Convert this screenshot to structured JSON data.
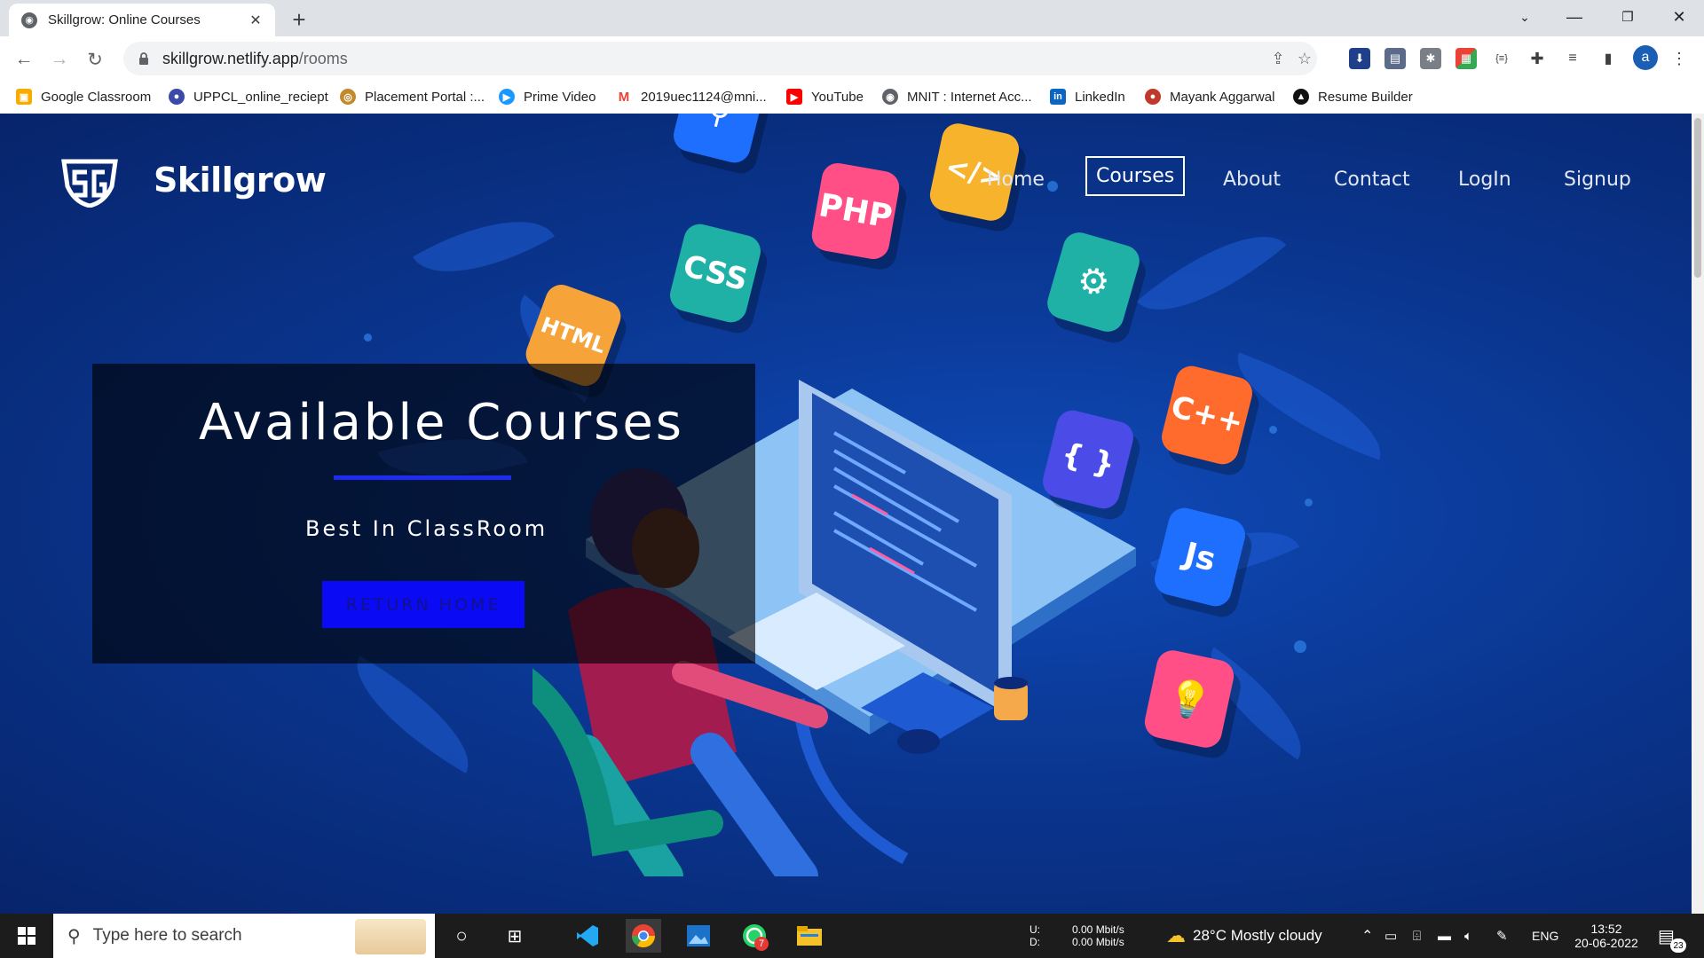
{
  "browser": {
    "tab_title": "Skillgrow: Online Courses",
    "url_host": "skillgrow.netlify.app",
    "url_path": "/rooms",
    "profile_initial": "a"
  },
  "bookmarks": [
    {
      "label": "Google Classroom",
      "icon": "classroom-icon",
      "color": "#f9ab00"
    },
    {
      "label": "UPPCL_online_reciept",
      "icon": "uppcl-icon",
      "color": "#3b4aa8"
    },
    {
      "label": "Placement Portal :...",
      "icon": "placement-icon",
      "color": "#c28a2e"
    },
    {
      "label": "Prime Video",
      "icon": "prime-video-icon",
      "color": "#1a98ff"
    },
    {
      "label": "2019uec1124@mni...",
      "icon": "gmail-icon",
      "color": "#ea4335"
    },
    {
      "label": "YouTube",
      "icon": "youtube-icon",
      "color": "#ff0000"
    },
    {
      "label": "MNIT : Internet Acc...",
      "icon": "globe-icon",
      "color": "#5f6368"
    },
    {
      "label": "LinkedIn",
      "icon": "linkedin-icon",
      "color": "#0a66c2"
    },
    {
      "label": "Mayank Aggarwal",
      "icon": "profile-icon",
      "color": "#c0392b"
    },
    {
      "label": "Resume Builder",
      "icon": "resume-icon",
      "color": "#111111"
    }
  ],
  "site": {
    "brand": "Skillgrow",
    "nav": [
      "Home",
      "Courses",
      "About",
      "Contact",
      "LogIn",
      "Signup"
    ],
    "active_nav": "Courses",
    "hero_title": "Available Courses",
    "hero_subtitle": "Best In ClassRoom",
    "hero_button": "RETURN HOME",
    "cube_labels": [
      "PHP",
      "CSS",
      "HTML",
      "</>",
      "C++",
      "{ }",
      "Js"
    ]
  },
  "taskbar": {
    "search_placeholder": "Type here to search",
    "net_up_label": "U:",
    "net_down_label": "D:",
    "net_up": "0.00 Mbit/s",
    "net_down": "0.00 Mbit/s",
    "weather": "28°C  Mostly cloudy",
    "lang": "ENG",
    "time": "13:52",
    "date": "20-06-2022",
    "notifications": "23",
    "whatsapp_badge": "7"
  }
}
